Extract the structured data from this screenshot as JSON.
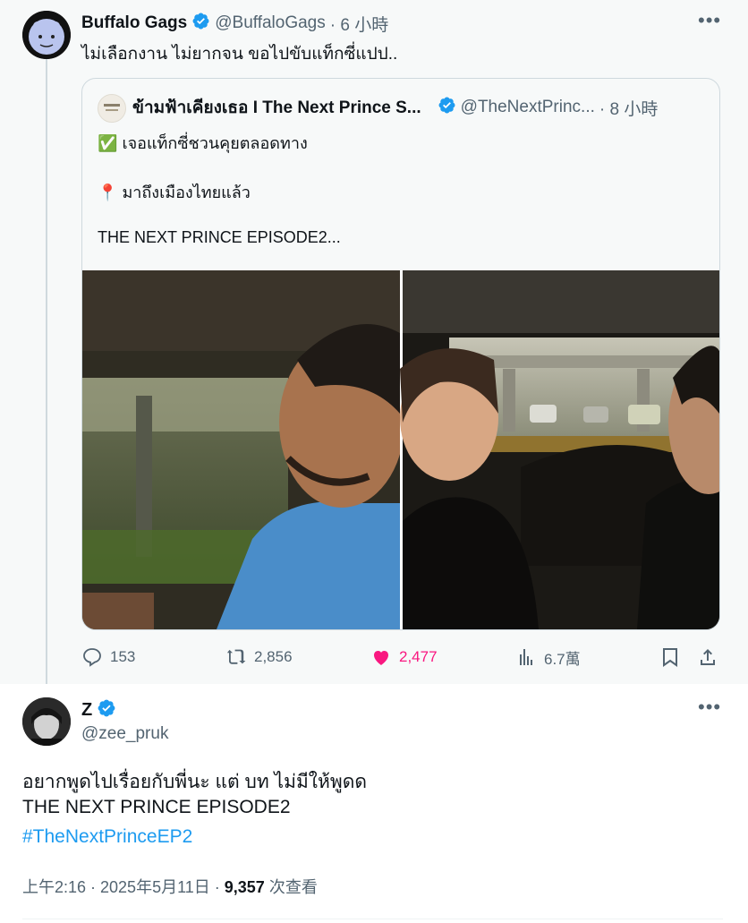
{
  "colors": {
    "accent": "#1d9bf0",
    "like": "#f91880",
    "muted": "#536471",
    "text": "#0f1419"
  },
  "parent_tweet": {
    "author_name": "Buffalo Gags",
    "author_handle": "@BuffaloGags",
    "time": "· 6 小時",
    "text": "ไม่เลือกงาน ไม่ยากจน ขอไปขับแท็กซี่แปป..",
    "quote": {
      "author_name": "ข้ามฟ้าเคียงเธอ I The Next Prince S...",
      "author_handle": "@TheNextPrinc...",
      "time": "· 8 小時",
      "line1_emoji": "✅",
      "line1": "เจอแท็กซี่ชวนคุยตลอดทาง",
      "line2_emoji": "📍",
      "line2": "มาถึงเมืองไทยแล้ว",
      "line3": "THE NEXT PRINCE EPISODE2..."
    },
    "actions": {
      "replies": "153",
      "retweets": "2,856",
      "likes": "2,477",
      "views": "6.7萬"
    }
  },
  "main_tweet": {
    "author_name": "Z",
    "author_handle": "@zee_pruk",
    "text_line1": "อยากพูดไปเรื่อยกับพี่นะ แต่ บท ไม่มีให้พูดด",
    "text_line2": "THE NEXT PRINCE EPISODE2",
    "hashtag": "#TheNextPrinceEP2",
    "time": "上午2:16 · 2025年5月11日 · ",
    "views_count": "9,357",
    "views_label": " 次查看"
  }
}
